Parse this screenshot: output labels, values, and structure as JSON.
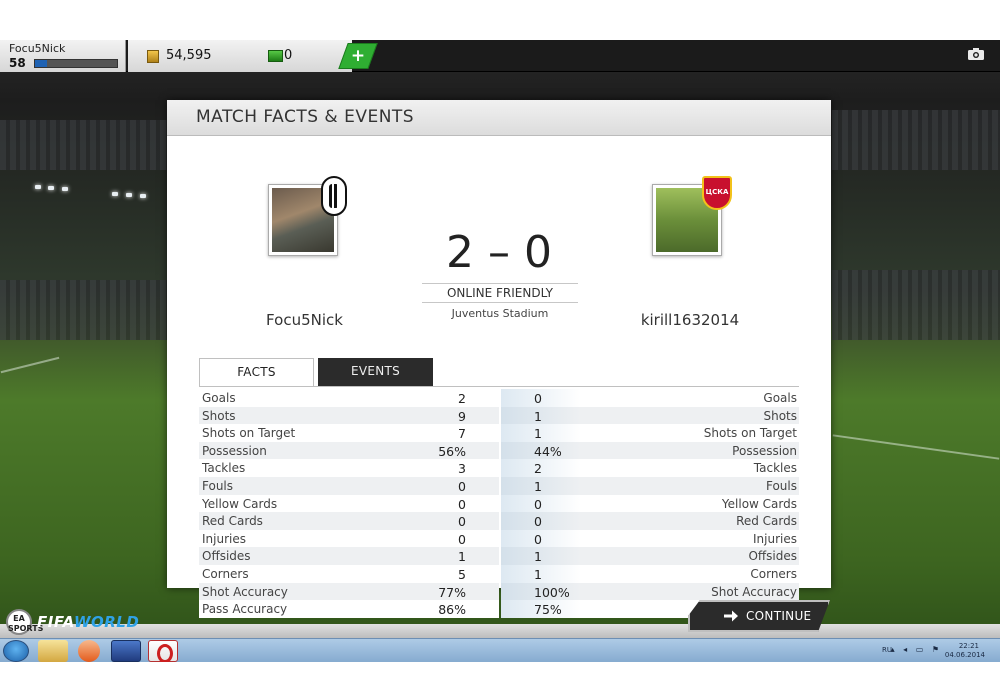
{
  "topbar": {
    "player_name": "Focu5Nick",
    "player_level": "58",
    "xp_progress": 0.15,
    "coins": "54,595",
    "fifa_points": "0",
    "add_points_symbol": "+"
  },
  "panel": {
    "title": "MATCH FACTS & EVENTS",
    "home": {
      "name": "Focu5Nick"
    },
    "away": {
      "name": "kirill1632014",
      "badge_text": "ЦСКА"
    },
    "score": "2 – 0",
    "match_type": "ONLINE FRIENDLY",
    "stadium": "Juventus Stadium",
    "tabs": [
      {
        "label": "FACTS",
        "active": true
      },
      {
        "label": "EVENTS",
        "active": false
      }
    ],
    "stats": [
      {
        "label": "Goals",
        "home": "2",
        "away": "0"
      },
      {
        "label": "Shots",
        "home": "9",
        "away": "1"
      },
      {
        "label": "Shots on Target",
        "home": "7",
        "away": "1"
      },
      {
        "label": "Possession",
        "home": "56%",
        "away": "44%"
      },
      {
        "label": "Tackles",
        "home": "3",
        "away": "2"
      },
      {
        "label": "Fouls",
        "home": "0",
        "away": "1"
      },
      {
        "label": "Yellow Cards",
        "home": "0",
        "away": "0"
      },
      {
        "label": "Red Cards",
        "home": "0",
        "away": "0"
      },
      {
        "label": "Injuries",
        "home": "0",
        "away": "0"
      },
      {
        "label": "Offsides",
        "home": "1",
        "away": "1"
      },
      {
        "label": "Corners",
        "home": "5",
        "away": "1"
      },
      {
        "label": "Shot Accuracy",
        "home": "77%",
        "away": "100%"
      },
      {
        "label": "Pass Accuracy",
        "home": "86%",
        "away": "75%"
      }
    ]
  },
  "footer": {
    "logo_ea": "EA SPORTS",
    "logo_fifa": "FIFA",
    "logo_world": "WORLD",
    "continue_label": "CONTINUE"
  },
  "taskbar": {
    "language": "RU",
    "time": "22:21",
    "date": "04.06.2014"
  }
}
